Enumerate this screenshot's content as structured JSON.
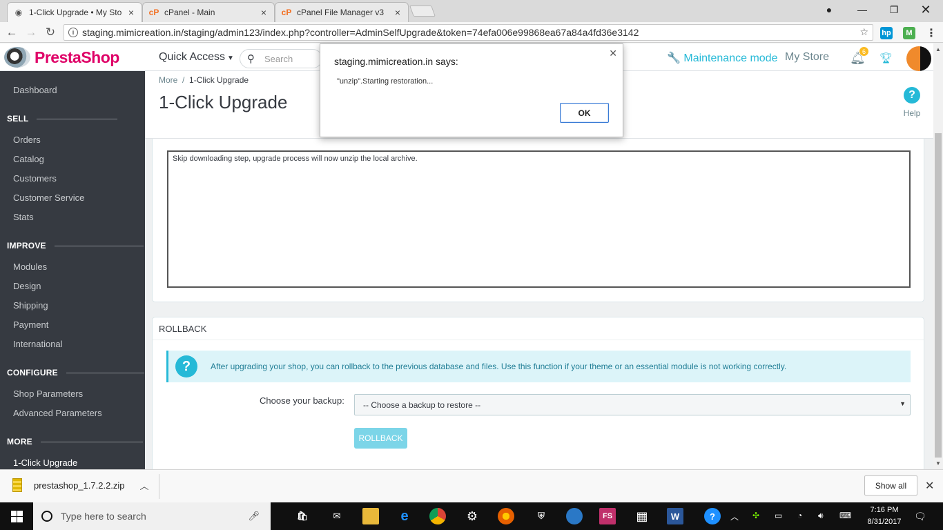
{
  "browser": {
    "tabs": [
      {
        "title": "1-Click Upgrade • My Sto",
        "close": "×"
      },
      {
        "title": "cPanel - Main",
        "close": "×"
      },
      {
        "title": "cPanel File Manager v3",
        "close": "×"
      }
    ],
    "url": "staging.mimicreation.in/staging/admin123/index.php?controller=AdminSelfUpgrade&token=74efa006e99868ea67a84a4fd36e3142"
  },
  "header": {
    "logo_text": "PrestaShop",
    "quick_access": "Quick Access",
    "search_placeholder": "Search",
    "maintenance": "Maintenance mode",
    "my_store": "My Store",
    "notification_count": "6"
  },
  "sidebar": {
    "dashboard": "Dashboard",
    "sections": [
      {
        "title": "SELL",
        "items": [
          "Orders",
          "Catalog",
          "Customers",
          "Customer Service",
          "Stats"
        ]
      },
      {
        "title": "IMPROVE",
        "items": [
          "Modules",
          "Design",
          "Shipping",
          "Payment",
          "International"
        ]
      },
      {
        "title": "CONFIGURE",
        "items": [
          "Shop Parameters",
          "Advanced Parameters"
        ]
      },
      {
        "title": "MORE",
        "items": [
          "1-Click Upgrade"
        ]
      }
    ]
  },
  "page": {
    "breadcrumb_root": "More",
    "breadcrumb_sep": "/",
    "breadcrumb_current": "1-Click Upgrade",
    "title": "1-Click Upgrade",
    "help_label": "Help"
  },
  "log": {
    "text": "Skip downloading step, upgrade process will now unzip the local archive."
  },
  "rollback": {
    "heading": "ROLLBACK",
    "info": "After upgrading your shop, you can rollback to the previous database and files. Use this function if your theme or an essential module is not working correctly.",
    "backup_label": "Choose your backup:",
    "backup_selected": "-- Choose a backup to restore --",
    "button": "ROLLBACK"
  },
  "dialog": {
    "title": "staging.mimicreation.in says:",
    "message": "\"unzip\".Starting restoration...",
    "ok": "OK"
  },
  "downloads": {
    "file": "prestashop_1.7.2.2.zip",
    "show_all": "Show all"
  },
  "taskbar": {
    "search_placeholder": "Type here to search",
    "time": "7:16 PM",
    "date": "8/31/2017"
  },
  "colors": {
    "accent": "#25b9d7",
    "brand": "#df0067",
    "sidebar": "#363a41"
  }
}
